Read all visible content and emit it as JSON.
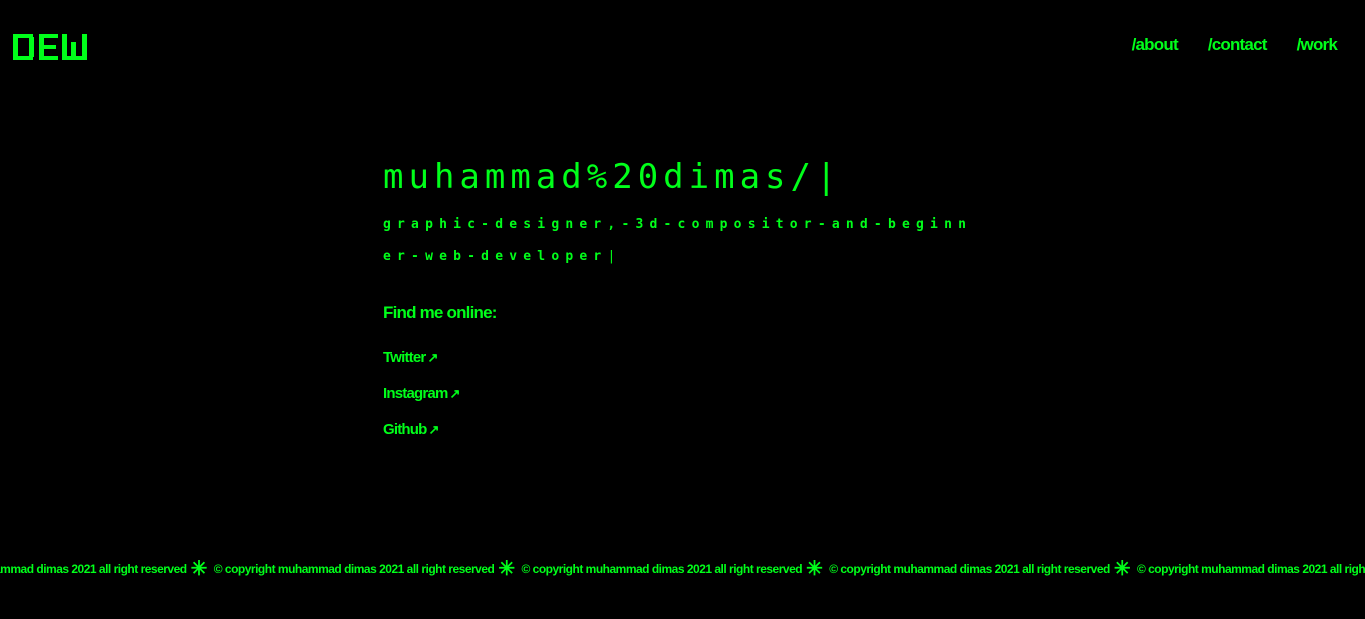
{
  "brand": {
    "logo_text": "DEW"
  },
  "nav": {
    "items": [
      {
        "label": "/about"
      },
      {
        "label": "/contact"
      },
      {
        "label": "/work"
      }
    ]
  },
  "hero": {
    "name": "muhammad%20dimas/",
    "tagline": "graphic-designer,-3d-compositor-and-beginner-web-developer"
  },
  "find_me": {
    "title": "Find me online:",
    "links": [
      {
        "label": "Twitter",
        "arrow": "↗"
      },
      {
        "label": "Instagram",
        "arrow": "↗"
      },
      {
        "label": "Github",
        "arrow": "↗"
      }
    ]
  },
  "footer": {
    "marquee_text": "© copyright muhammad dimas 2021 all right reserved",
    "separator": "✳"
  },
  "colors": {
    "background": "#000000",
    "accent": "#00ff1a"
  }
}
